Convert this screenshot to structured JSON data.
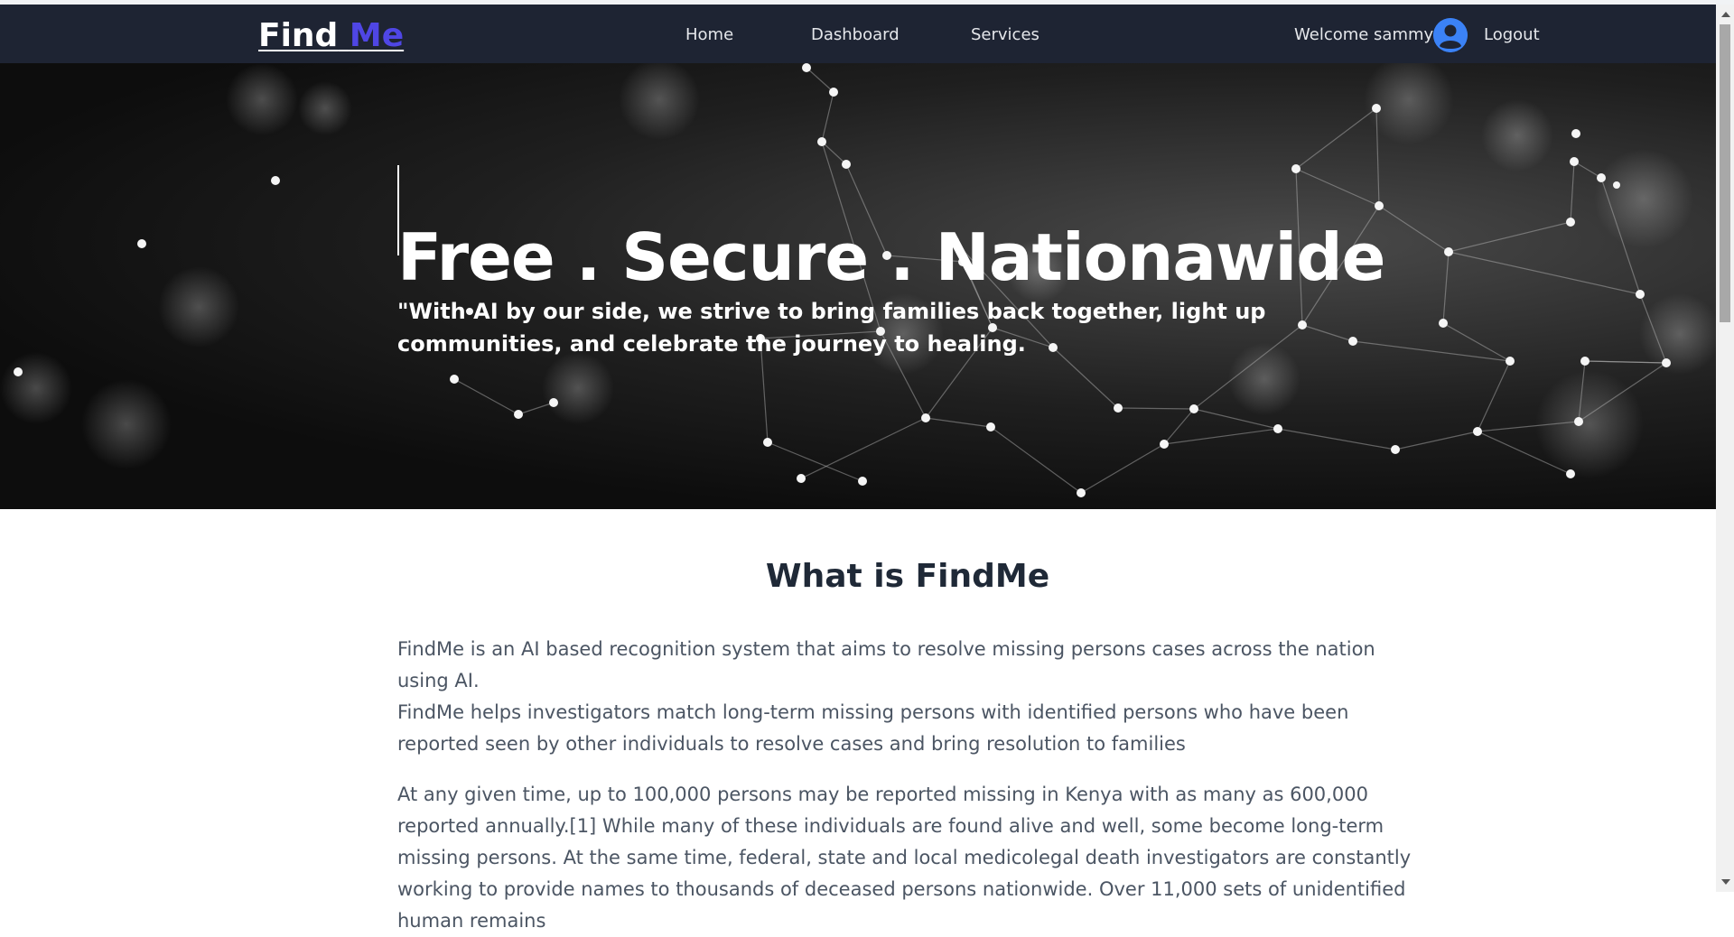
{
  "navbar": {
    "logo_part1": "Find",
    "logo_part2": "Me",
    "links": [
      "Home",
      "Dashboard",
      "Services"
    ],
    "welcome": "Welcome sammy",
    "logout": "Logout",
    "avatar_icon": "user-circle-icon"
  },
  "hero": {
    "title": "Free . Secure . Nationawide",
    "quote": "\"With AI by our side, we strive to bring families back together, light up communities, and celebrate the journey to healing."
  },
  "about": {
    "title": "What is FindMe",
    "para1": "FindMe is an AI based recognition system that aims to resolve missing persons cases across the nation using AI.",
    "para2": "FindMe helps investigators match long-term missing persons with identified persons who have been reported seen by other individuals to resolve cases and bring resolution to families",
    "para3": "At any given time, up to 100,000 persons may be reported missing in Kenya with as many as 600,000 reported annually.[1] While many of these individuals are found alive and well, some become long-term missing persons. At the same time, federal, state and local medicolegal death investigators are constantly working to provide names to thousands of deceased persons nationwide. Over 11,000 sets of unidentified human remains"
  },
  "colors": {
    "navbar_bg": "#1e2433",
    "logo_accent": "#4f46e5",
    "avatar": "#3b82f6"
  }
}
